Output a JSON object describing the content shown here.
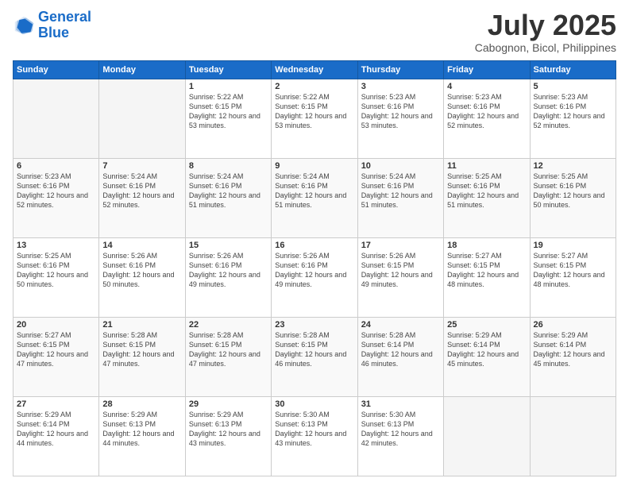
{
  "logo": {
    "line1": "General",
    "line2": "Blue"
  },
  "header": {
    "month": "July 2025",
    "location": "Cabognon, Bicol, Philippines"
  },
  "weekdays": [
    "Sunday",
    "Monday",
    "Tuesday",
    "Wednesday",
    "Thursday",
    "Friday",
    "Saturday"
  ],
  "weeks": [
    [
      {
        "day": "",
        "sunrise": "",
        "sunset": "",
        "daylight": ""
      },
      {
        "day": "",
        "sunrise": "",
        "sunset": "",
        "daylight": ""
      },
      {
        "day": "1",
        "sunrise": "Sunrise: 5:22 AM",
        "sunset": "Sunset: 6:15 PM",
        "daylight": "Daylight: 12 hours and 53 minutes."
      },
      {
        "day": "2",
        "sunrise": "Sunrise: 5:22 AM",
        "sunset": "Sunset: 6:15 PM",
        "daylight": "Daylight: 12 hours and 53 minutes."
      },
      {
        "day": "3",
        "sunrise": "Sunrise: 5:23 AM",
        "sunset": "Sunset: 6:16 PM",
        "daylight": "Daylight: 12 hours and 53 minutes."
      },
      {
        "day": "4",
        "sunrise": "Sunrise: 5:23 AM",
        "sunset": "Sunset: 6:16 PM",
        "daylight": "Daylight: 12 hours and 52 minutes."
      },
      {
        "day": "5",
        "sunrise": "Sunrise: 5:23 AM",
        "sunset": "Sunset: 6:16 PM",
        "daylight": "Daylight: 12 hours and 52 minutes."
      }
    ],
    [
      {
        "day": "6",
        "sunrise": "Sunrise: 5:23 AM",
        "sunset": "Sunset: 6:16 PM",
        "daylight": "Daylight: 12 hours and 52 minutes."
      },
      {
        "day": "7",
        "sunrise": "Sunrise: 5:24 AM",
        "sunset": "Sunset: 6:16 PM",
        "daylight": "Daylight: 12 hours and 52 minutes."
      },
      {
        "day": "8",
        "sunrise": "Sunrise: 5:24 AM",
        "sunset": "Sunset: 6:16 PM",
        "daylight": "Daylight: 12 hours and 51 minutes."
      },
      {
        "day": "9",
        "sunrise": "Sunrise: 5:24 AM",
        "sunset": "Sunset: 6:16 PM",
        "daylight": "Daylight: 12 hours and 51 minutes."
      },
      {
        "day": "10",
        "sunrise": "Sunrise: 5:24 AM",
        "sunset": "Sunset: 6:16 PM",
        "daylight": "Daylight: 12 hours and 51 minutes."
      },
      {
        "day": "11",
        "sunrise": "Sunrise: 5:25 AM",
        "sunset": "Sunset: 6:16 PM",
        "daylight": "Daylight: 12 hours and 51 minutes."
      },
      {
        "day": "12",
        "sunrise": "Sunrise: 5:25 AM",
        "sunset": "Sunset: 6:16 PM",
        "daylight": "Daylight: 12 hours and 50 minutes."
      }
    ],
    [
      {
        "day": "13",
        "sunrise": "Sunrise: 5:25 AM",
        "sunset": "Sunset: 6:16 PM",
        "daylight": "Daylight: 12 hours and 50 minutes."
      },
      {
        "day": "14",
        "sunrise": "Sunrise: 5:26 AM",
        "sunset": "Sunset: 6:16 PM",
        "daylight": "Daylight: 12 hours and 50 minutes."
      },
      {
        "day": "15",
        "sunrise": "Sunrise: 5:26 AM",
        "sunset": "Sunset: 6:16 PM",
        "daylight": "Daylight: 12 hours and 49 minutes."
      },
      {
        "day": "16",
        "sunrise": "Sunrise: 5:26 AM",
        "sunset": "Sunset: 6:16 PM",
        "daylight": "Daylight: 12 hours and 49 minutes."
      },
      {
        "day": "17",
        "sunrise": "Sunrise: 5:26 AM",
        "sunset": "Sunset: 6:15 PM",
        "daylight": "Daylight: 12 hours and 49 minutes."
      },
      {
        "day": "18",
        "sunrise": "Sunrise: 5:27 AM",
        "sunset": "Sunset: 6:15 PM",
        "daylight": "Daylight: 12 hours and 48 minutes."
      },
      {
        "day": "19",
        "sunrise": "Sunrise: 5:27 AM",
        "sunset": "Sunset: 6:15 PM",
        "daylight": "Daylight: 12 hours and 48 minutes."
      }
    ],
    [
      {
        "day": "20",
        "sunrise": "Sunrise: 5:27 AM",
        "sunset": "Sunset: 6:15 PM",
        "daylight": "Daylight: 12 hours and 47 minutes."
      },
      {
        "day": "21",
        "sunrise": "Sunrise: 5:28 AM",
        "sunset": "Sunset: 6:15 PM",
        "daylight": "Daylight: 12 hours and 47 minutes."
      },
      {
        "day": "22",
        "sunrise": "Sunrise: 5:28 AM",
        "sunset": "Sunset: 6:15 PM",
        "daylight": "Daylight: 12 hours and 47 minutes."
      },
      {
        "day": "23",
        "sunrise": "Sunrise: 5:28 AM",
        "sunset": "Sunset: 6:15 PM",
        "daylight": "Daylight: 12 hours and 46 minutes."
      },
      {
        "day": "24",
        "sunrise": "Sunrise: 5:28 AM",
        "sunset": "Sunset: 6:14 PM",
        "daylight": "Daylight: 12 hours and 46 minutes."
      },
      {
        "day": "25",
        "sunrise": "Sunrise: 5:29 AM",
        "sunset": "Sunset: 6:14 PM",
        "daylight": "Daylight: 12 hours and 45 minutes."
      },
      {
        "day": "26",
        "sunrise": "Sunrise: 5:29 AM",
        "sunset": "Sunset: 6:14 PM",
        "daylight": "Daylight: 12 hours and 45 minutes."
      }
    ],
    [
      {
        "day": "27",
        "sunrise": "Sunrise: 5:29 AM",
        "sunset": "Sunset: 6:14 PM",
        "daylight": "Daylight: 12 hours and 44 minutes."
      },
      {
        "day": "28",
        "sunrise": "Sunrise: 5:29 AM",
        "sunset": "Sunset: 6:13 PM",
        "daylight": "Daylight: 12 hours and 44 minutes."
      },
      {
        "day": "29",
        "sunrise": "Sunrise: 5:29 AM",
        "sunset": "Sunset: 6:13 PM",
        "daylight": "Daylight: 12 hours and 43 minutes."
      },
      {
        "day": "30",
        "sunrise": "Sunrise: 5:30 AM",
        "sunset": "Sunset: 6:13 PM",
        "daylight": "Daylight: 12 hours and 43 minutes."
      },
      {
        "day": "31",
        "sunrise": "Sunrise: 5:30 AM",
        "sunset": "Sunset: 6:13 PM",
        "daylight": "Daylight: 12 hours and 42 minutes."
      },
      {
        "day": "",
        "sunrise": "",
        "sunset": "",
        "daylight": ""
      },
      {
        "day": "",
        "sunrise": "",
        "sunset": "",
        "daylight": ""
      }
    ]
  ]
}
